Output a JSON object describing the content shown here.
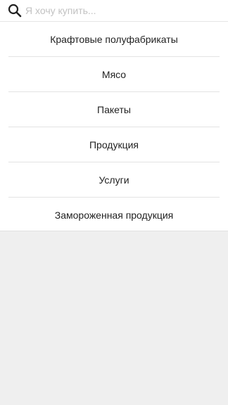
{
  "search": {
    "icon": "search-icon",
    "placeholder": "Я хочу купить..."
  },
  "categories": [
    {
      "label": "Крафтовые полуфабрикаты"
    },
    {
      "label": "Мясо"
    },
    {
      "label": "Пакеты"
    },
    {
      "label": "Продукция"
    },
    {
      "label": "Услуги"
    },
    {
      "label": "Замороженная продукция"
    }
  ],
  "colors": {
    "background": "#efefef",
    "panel": "#ffffff",
    "divider": "#e3e3e3",
    "text": "#222222",
    "placeholder": "#c2c2c2"
  }
}
